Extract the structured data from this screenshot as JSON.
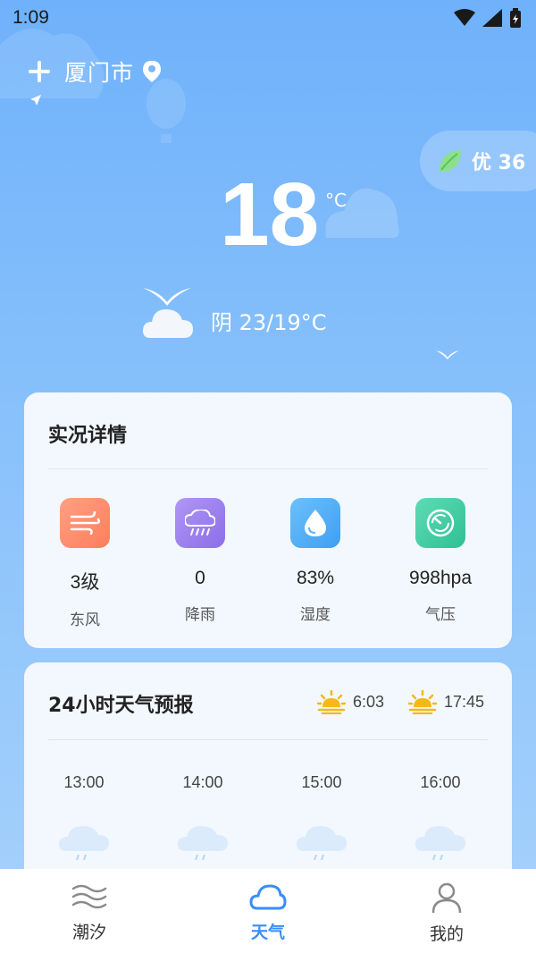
{
  "status_bar": {
    "time": "1:09"
  },
  "header": {
    "city": "厦门市"
  },
  "aqi": {
    "label": "优 36"
  },
  "current": {
    "temperature": "18",
    "unit": "°C",
    "condition": "阴 23/19°C"
  },
  "details": {
    "title": "实况详情",
    "items": [
      {
        "value": "3级",
        "label": "东风",
        "icon": "wind-icon",
        "color": "#ff8b6a"
      },
      {
        "value": "0",
        "label": "降雨",
        "icon": "rain-icon",
        "color": "#9b7cf0"
      },
      {
        "value": "83%",
        "label": "湿度",
        "icon": "humidity-icon",
        "color": "#4aa8f5"
      },
      {
        "value": "998hpa",
        "label": "气压",
        "icon": "pressure-icon",
        "color": "#36c9a1"
      }
    ]
  },
  "forecast": {
    "title": "24小时天气预报",
    "sunrise": "6:03",
    "sunset": "17:45",
    "hours": [
      "13:00",
      "14:00",
      "15:00",
      "16:00"
    ]
  },
  "bottom_nav": {
    "items": [
      {
        "label": "潮汐",
        "icon": "tide-icon"
      },
      {
        "label": "天气",
        "icon": "cloud-icon",
        "active": true
      },
      {
        "label": "我的",
        "icon": "person-icon"
      }
    ]
  },
  "colors": {
    "accent": "#3a8ef5",
    "sun": "#f6b719"
  }
}
